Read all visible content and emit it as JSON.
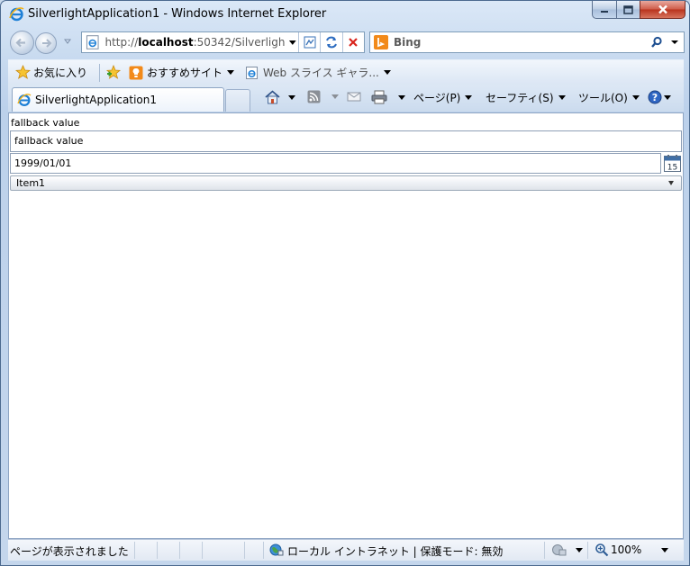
{
  "window": {
    "title": "SilverlightApplication1 - Windows Internet Explorer"
  },
  "navigation": {
    "address_prefix": "http://",
    "address_host": "localhost",
    "address_rest": ":50342/Silverlight",
    "search_placeholder": "Bing"
  },
  "favorites_bar": {
    "favorites_label": "お気に入り",
    "suggested_sites_label": "おすすめサイト",
    "web_slice_label": "Web スライス ギャラ..."
  },
  "tabs": [
    {
      "label": "SilverlightApplication1",
      "active": true
    }
  ],
  "command_bar": {
    "page_label": "ページ(P)",
    "safety_label": "セーフティ(S)",
    "tools_label": "ツール(O)"
  },
  "content": {
    "label_text": "fallback value",
    "textbox_value": "fallback value",
    "date_value": "1999/01/01",
    "calendar_day": "15",
    "combobox_selected": "Item1"
  },
  "status_bar": {
    "status_text": "ページが表示されました",
    "zone_text": "ローカル イントラネット | 保護モード: 無効",
    "zoom_text": "100%"
  },
  "colors": {
    "frame": "#4c6a8f",
    "close_button": "#c4402b",
    "bing": "#f28a1a",
    "stop_red": "#d9241c"
  }
}
